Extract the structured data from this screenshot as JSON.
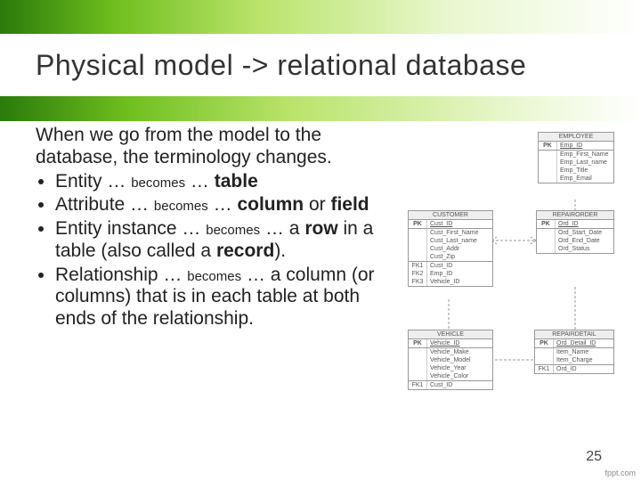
{
  "title": "Physical model -> relational database",
  "intro": "When we go from the model to the database, the terminology changes.",
  "bullets": [
    {
      "head": "Entity",
      "tail_html": "<span class='b'>table</span>"
    },
    {
      "head": "Attribute",
      "tail_html": "<span class='b'>column</span> or <span class='b'>field</span>"
    },
    {
      "head": "Entity instance",
      "tail_html": "a <span class='b'>row</span> in a table (also called a <span class='b'>record</span>)."
    },
    {
      "head": "Relationship",
      "tail_html": "a column (or columns) that is in each table at both ends of the relationship."
    }
  ],
  "becomes_word": "becomes",
  "page_number": "25",
  "footer_logo": "fppt.com",
  "er": {
    "employee": {
      "title": "EMPLOYEE",
      "pk": "PK",
      "pk_field": "Emp_ID",
      "fields": [
        "Emp_First_Name",
        "Emp_Last_name",
        "Emp_Title",
        "Emp_Email"
      ]
    },
    "customer": {
      "title": "CUSTOMER",
      "pk": "PK",
      "pk_field": "Cust_ID",
      "fields": [
        "Cust_First_Name",
        "Cust_Last_name",
        "Cust_Addr",
        "Cust_Zip"
      ],
      "fks": [
        [
          "FK1",
          "Cust_ID"
        ],
        [
          "FK2",
          "Emp_ID"
        ],
        [
          "FK3",
          "Vehicle_ID"
        ]
      ]
    },
    "repairorder": {
      "title": "REPAIRORDER",
      "pk": "PK",
      "pk_field": "Ord_ID",
      "fields": [
        "Ord_Start_Date",
        "Ord_End_Date",
        "Ord_Status"
      ]
    },
    "vehicle": {
      "title": "VEHICLE",
      "pk": "PK",
      "pk_field": "Vehicle_ID",
      "fields": [
        "Vehicle_Make",
        "Vehicle_Model",
        "Vehicle_Year",
        "Vehicle_Color"
      ],
      "fks": [
        [
          "FK1",
          "Cust_ID"
        ]
      ]
    },
    "repairdetail": {
      "title": "REPAIRDETAIL",
      "pk": "PK",
      "pk_field": "Ord_Detail_ID",
      "fields": [
        "Item_Name",
        "Item_Charge"
      ],
      "fks": [
        [
          "FK1",
          "Ord_ID"
        ]
      ]
    }
  }
}
